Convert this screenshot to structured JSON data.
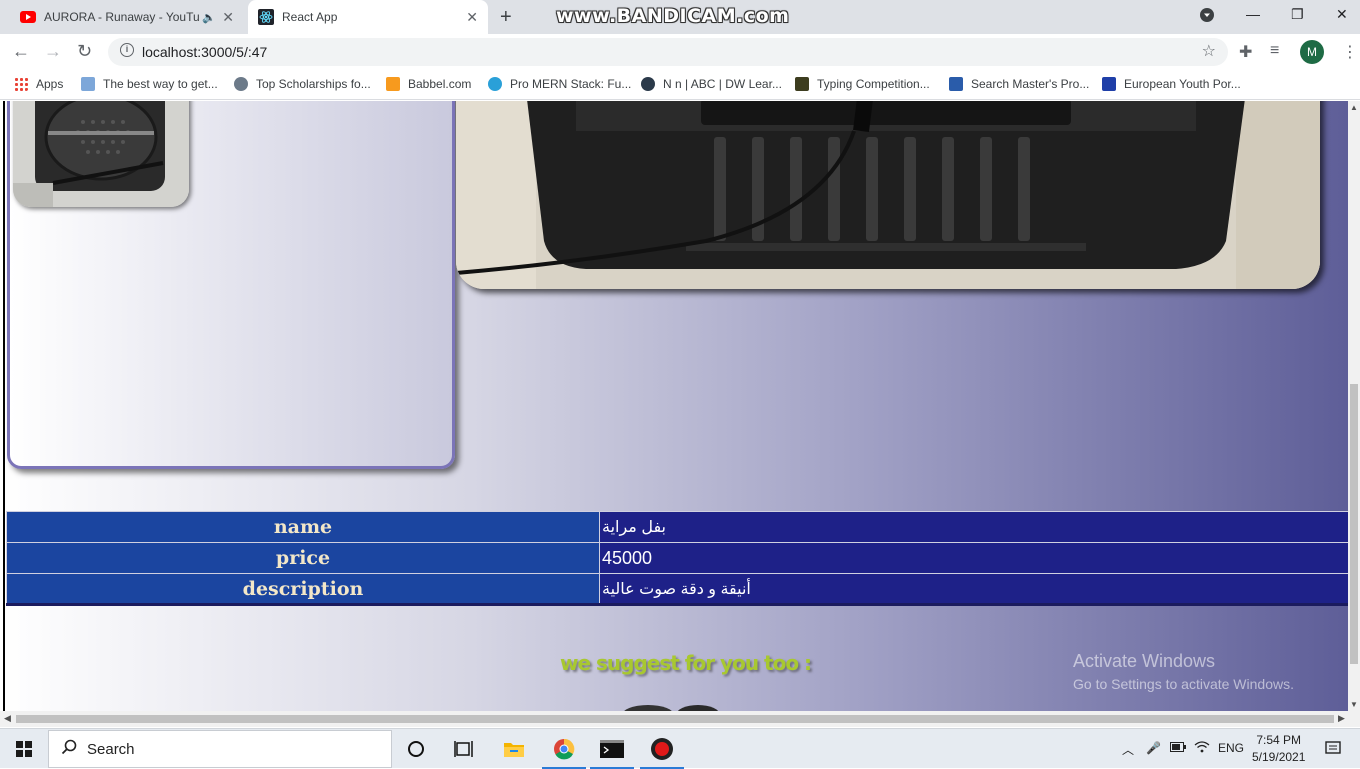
{
  "browser": {
    "tabs": [
      {
        "title": "AURORA - Runaway - YouTu",
        "favicon": "youtube-icon",
        "audio": true
      },
      {
        "title": "React App",
        "favicon": "react-icon",
        "active": true
      }
    ],
    "watermark": "www.BANDICAM.com",
    "url": "localhost:3000/5/:47",
    "profile_initial": "M",
    "bookmarks": [
      {
        "label": "Apps",
        "icon": "apps-grid-icon",
        "color": "#e94235"
      },
      {
        "label": "The best way to get...",
        "icon": "toefl-icon",
        "color": "#7da7d9"
      },
      {
        "label": "Top Scholarships fo...",
        "icon": "scholarship-icon",
        "color": "#6c7a89"
      },
      {
        "label": "Babbel.com",
        "icon": "babbel-icon",
        "color": "#f79a1e"
      },
      {
        "label": "Pro MERN Stack: Fu...",
        "icon": "mern-icon",
        "color": "#2aa0d8"
      },
      {
        "label": "N n | ABC | DW Lear...",
        "icon": "dw-icon",
        "color": "#2b3a4a"
      },
      {
        "label": "Typing Competition...",
        "icon": "typing-icon",
        "color": "#3d3d1f"
      },
      {
        "label": "Search Master's Pro...",
        "icon": "masters-icon",
        "color": "#2a5caa"
      },
      {
        "label": "European Youth Por...",
        "icon": "eu-flag-icon",
        "color": "#1f3fa8"
      }
    ]
  },
  "product": {
    "fields": [
      {
        "key": "name",
        "value": "بفل مراية"
      },
      {
        "key": "price",
        "value": "45000"
      },
      {
        "key": "description",
        "value": "أنيقة و دقة صوت عالية"
      }
    ],
    "suggest_heading": "we suggest for you too :"
  },
  "windows_activation": {
    "line1": "Activate Windows",
    "line2": "Go to Settings to activate Windows."
  },
  "taskbar": {
    "search_placeholder": "Search",
    "language": "ENG",
    "time": "7:54 PM",
    "date": "5/19/2021"
  }
}
